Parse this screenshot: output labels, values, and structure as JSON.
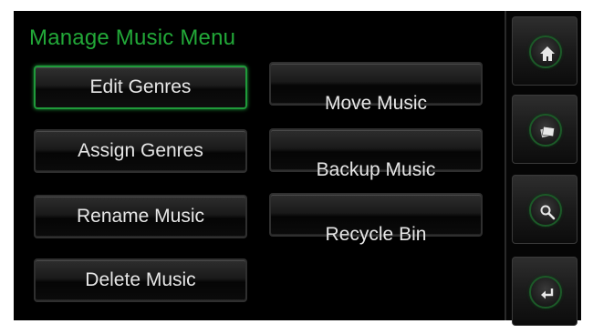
{
  "menu": {
    "title": "Manage Music Menu",
    "left_buttons": [
      {
        "label": "Edit Genres",
        "selected": true
      },
      {
        "label": "Assign Genres",
        "selected": false
      },
      {
        "label": "Rename Music",
        "selected": false
      },
      {
        "label": "Delete Music",
        "selected": false
      }
    ],
    "right_buttons": [
      {
        "label": "Move Music"
      },
      {
        "label": "Backup Music"
      },
      {
        "label": "Recycle Bin"
      }
    ]
  },
  "sidebar": {
    "icons": [
      "home-icon",
      "photos-icon",
      "search-icon",
      "back-icon"
    ]
  },
  "colors": {
    "accent": "#22a838",
    "selected_border": "#1f9a3a",
    "text": "#e6e6e6",
    "background": "#000000"
  }
}
